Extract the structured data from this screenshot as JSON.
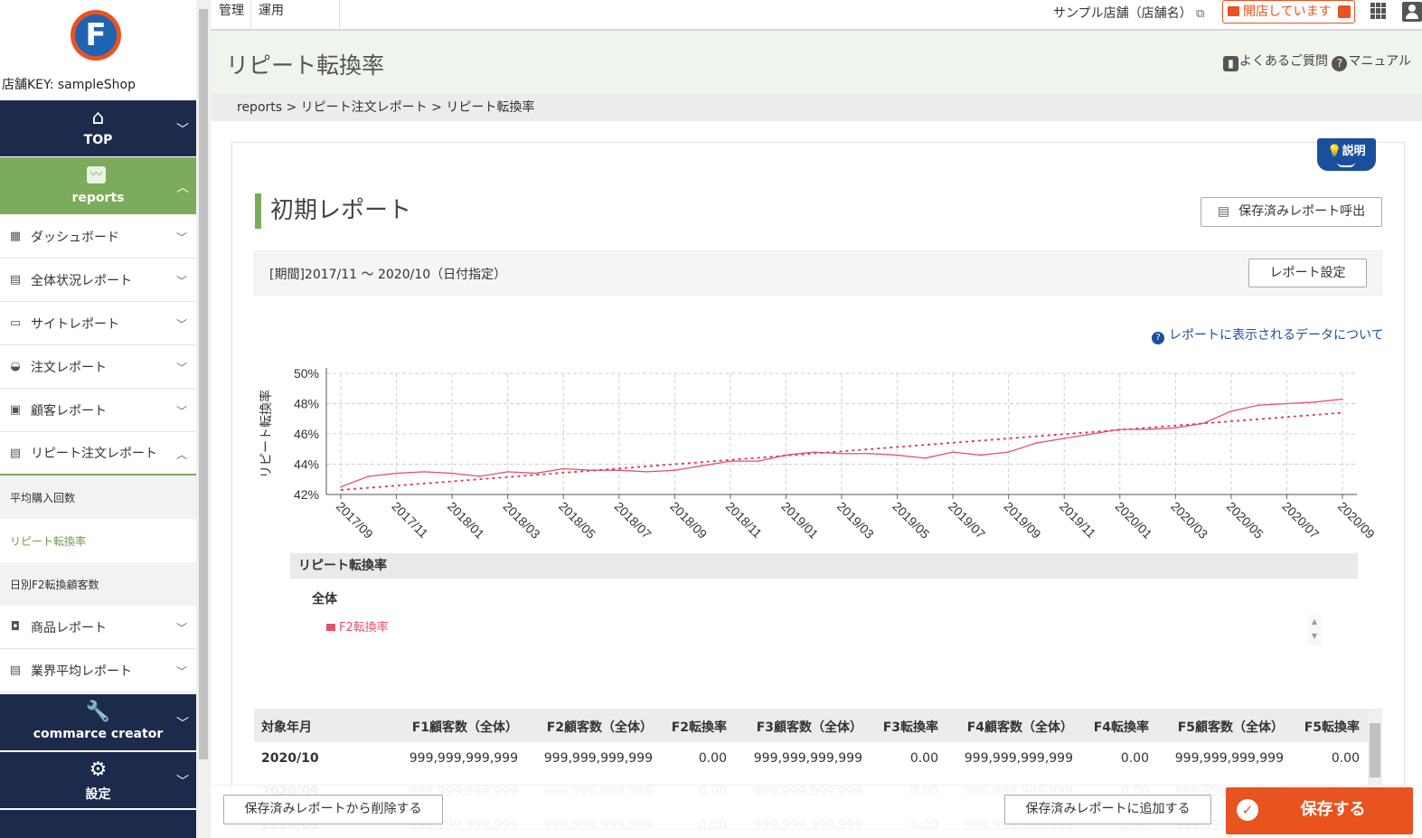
{
  "sidebar": {
    "logo_letter": "F",
    "shop_key": "店舗KEY: sampleShop",
    "top_label": "TOP",
    "reports_label": "reports",
    "items": [
      {
        "label": "ダッシュボード",
        "icon": "dashboard-icon"
      },
      {
        "label": "全体状況レポート",
        "icon": "clipboard-icon"
      },
      {
        "label": "サイトレポート",
        "icon": "monitor-icon"
      },
      {
        "label": "注文レポート",
        "icon": "basket-icon"
      },
      {
        "label": "顧客レポート",
        "icon": "customer-card-icon"
      },
      {
        "label": "リピート注文レポート",
        "icon": "clipboard-icon"
      }
    ],
    "sub_items": [
      "平均購入回数",
      "リピート転換率",
      "日別F2転換顧客数"
    ],
    "items_after": [
      {
        "label": "商品レポート",
        "icon": "bag-icon"
      },
      {
        "label": "業界平均レポート",
        "icon": "clipboard-icon"
      }
    ],
    "creator_label": "commarce creator",
    "settings_label": "設定"
  },
  "topbar": {
    "tabs": [
      "管理",
      "運用"
    ],
    "shop_name": "サンプル店舗（店舗名）",
    "open_status": "開店しています"
  },
  "page": {
    "title": "リピート転換率",
    "faq": "よくあるご質問",
    "manual": "マニュアル",
    "breadcrumb": "reports > リピート注文レポート > リピート転換率",
    "explain": "説明",
    "report_title": "初期レポート",
    "load_saved": "保存済みレポート呼出",
    "period": "[期間]2017/11 ～ 2020/10（日付指定）",
    "report_settings": "レポート設定",
    "data_link": "レポートに表示されるデータについて"
  },
  "legend": {
    "header": "リピート転換率",
    "group": "全体",
    "item": "F2転換率"
  },
  "colors": {
    "accent_green": "#7bab5b",
    "navy": "#1c2b4b",
    "orange": "#e8531f",
    "series": "#e2536b"
  },
  "chart_data": {
    "type": "line",
    "ylabel": "リピート転換率",
    "ylim": [
      42,
      50
    ],
    "yticks": [
      "42%",
      "44%",
      "46%",
      "48%",
      "50%"
    ],
    "xticks": [
      "2017/09",
      "2017/11",
      "2018/01",
      "2018/03",
      "2018/05",
      "2018/07",
      "2018/09",
      "2018/11",
      "2019/01",
      "2019/03",
      "2019/05",
      "2019/07",
      "2019/09",
      "2019/11",
      "2020/01",
      "2020/03",
      "2020/05",
      "2020/07",
      "2020/09"
    ],
    "x": [
      "2017/09",
      "2017/10",
      "2017/11",
      "2017/12",
      "2018/01",
      "2018/02",
      "2018/03",
      "2018/04",
      "2018/05",
      "2018/06",
      "2018/07",
      "2018/08",
      "2018/09",
      "2018/10",
      "2018/11",
      "2018/12",
      "2019/01",
      "2019/02",
      "2019/03",
      "2019/04",
      "2019/05",
      "2019/06",
      "2019/07",
      "2019/08",
      "2019/09",
      "2019/10",
      "2019/11",
      "2019/12",
      "2020/01",
      "2020/02",
      "2020/03",
      "2020/04",
      "2020/05",
      "2020/06",
      "2020/07",
      "2020/08",
      "2020/09"
    ],
    "series": [
      {
        "name": "F2転換率",
        "values": [
          42.5,
          43.2,
          43.4,
          43.5,
          43.4,
          43.2,
          43.5,
          43.4,
          43.7,
          43.6,
          43.6,
          43.5,
          43.6,
          43.9,
          44.2,
          44.2,
          44.6,
          44.8,
          44.7,
          44.7,
          44.6,
          44.4,
          44.8,
          44.6,
          44.8,
          45.4,
          45.7,
          46.0,
          46.3,
          46.3,
          46.4,
          46.7,
          47.5,
          47.9,
          48.0,
          48.1,
          48.3
        ]
      },
      {
        "name": "trend",
        "values": [
          42.3,
          47.4
        ]
      }
    ],
    "grid": true
  },
  "table": {
    "headers": [
      "対象年月",
      "F1顧客数（全体）",
      "F2顧客数（全体）",
      "F2転換率",
      "F3顧客数（全体）",
      "F3転換率",
      "F4顧客数（全体）",
      "F4転換率",
      "F5顧客数（全体）",
      "F5転換率"
    ],
    "rows": [
      [
        "2020/10",
        "999,999,999,999",
        "999,999,999,999",
        "0.00",
        "999,999,999,999",
        "0.00",
        "999,999,999,999",
        "0.00",
        "999,999,999,999",
        "0.00"
      ],
      [
        "2020/09",
        "999,999,999,999",
        "999,999,999,999",
        "0.00",
        "999,999,999,999",
        "0.00",
        "999,999,999,999",
        "0.00",
        "999,999,999,999",
        "0.00"
      ],
      [
        "2020/08",
        "999,999,999,999",
        "999,999,999,999",
        "0.00",
        "999,999,999,999",
        "0.00",
        "999,999,999,999",
        "0.00",
        "999,999,999,999",
        "0.00"
      ]
    ]
  },
  "footer": {
    "delete_saved": "保存済みレポートから削除する",
    "add_saved": "保存済みレポートに追加する",
    "save": "保存する"
  }
}
